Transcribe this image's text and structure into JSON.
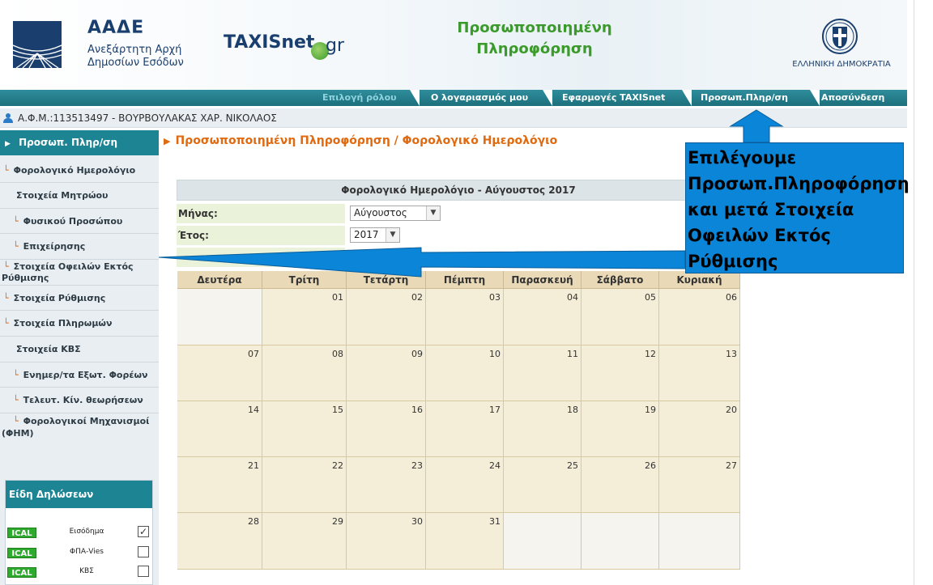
{
  "header": {
    "aade_title": "ΑΑΔΕ",
    "aade_sub1": "Ανεξάρτητη Αρχή",
    "aade_sub2": "Δημοσίων Εσόδων",
    "taxis_brand": "TAXISnet",
    "taxis_suffix": "gr",
    "title_line1": "Προσωποποιημένη",
    "title_line2": "Πληροφόρηση",
    "gov_label": "ΕΛΛΗΝΙΚΗ ΔΗΜΟΚΡΑΤΙΑ"
  },
  "topnav": {
    "tabs": [
      {
        "label": "Επιλογή ρόλου",
        "active": false
      },
      {
        "label": "Ο λογαριασμός μου",
        "active": true
      },
      {
        "label": "Εφαρμογές TAXISnet",
        "active": true
      },
      {
        "label": "Προσωπ.Πληρ/ση",
        "active": true
      },
      {
        "label": "Αποσύνδεση",
        "active": true
      }
    ]
  },
  "user": {
    "text": "Α.Φ.Μ.:113513497 - ΒΟΥΡΒΟΥΛΑΚΑΣ ΧΑΡ. ΝΙΚΟΛΑΟΣ"
  },
  "sidebar": {
    "active": "Προσωπ. Πληρ/ση",
    "items": [
      {
        "label": "Φορολογικό Ημερολόγιο",
        "bullet": true
      },
      {
        "label": "Στοιχεία Μητρώου",
        "bullet": false
      },
      {
        "label": "Φυσικού Προσώπου",
        "bullet": true
      },
      {
        "label": "Επιχείρησης",
        "bullet": true
      },
      {
        "label": "Στοιχεία Οφειλών Εκτός Ρύθμισης",
        "bullet": true
      },
      {
        "label": "Στοιχεία Ρύθμισης",
        "bullet": true
      },
      {
        "label": "Στοιχεία Πληρωμών",
        "bullet": true
      },
      {
        "label": "Στοιχεία ΚΒΣ",
        "bullet": false
      },
      {
        "label": "Ενημερ/τα Εξωτ. Φορέων",
        "bullet": true
      },
      {
        "label": "Τελευτ. Κίν. θεωρήσεων",
        "bullet": true
      },
      {
        "label": "Φορολογικοί Μηχανισμοί (ΦΗΜ)",
        "bullet": true
      }
    ],
    "declarations": {
      "title": "Είδη Δηλώσεων",
      "badge": "ICAL",
      "rows": [
        {
          "label": "Εισόδημα",
          "checked": true
        },
        {
          "label": "ΦΠΑ-Vies",
          "checked": false
        },
        {
          "label": "ΚΒΣ",
          "checked": false
        }
      ]
    }
  },
  "main": {
    "breadcrumb": "Προσωποποιημένη Πληροφόρηση / Φορολογικό Ημερολόγιο",
    "calendar_title": "Φορολογικό Ημερολόγιο - Αύγουστος 2017",
    "month_label": "Μήνας:",
    "month_value": "Αύγουστος",
    "year_label": "Έτος:",
    "year_value": "2017",
    "weekdays": [
      "Δευτέρα",
      "Τρίτη",
      "Τετάρτη",
      "Πέμπτη",
      "Παρασκευή",
      "Σάββατο",
      "Κυριακή"
    ],
    "weeks": [
      [
        "",
        "01",
        "02",
        "03",
        "04",
        "05",
        "06"
      ],
      [
        "07",
        "08",
        "09",
        "10",
        "11",
        "12",
        "13"
      ],
      [
        "14",
        "15",
        "16",
        "17",
        "18",
        "19",
        "20"
      ],
      [
        "21",
        "22",
        "23",
        "24",
        "25",
        "26",
        "27"
      ],
      [
        "28",
        "29",
        "30",
        "31",
        "",
        "",
        ""
      ]
    ]
  },
  "annotation": {
    "text": "Επιλέγουμε Προσωπ.Πληροφόρηση και μετά Στοιχεία Οφειλών Εκτός Ρύθμισης",
    "color": "#0b85d8"
  }
}
